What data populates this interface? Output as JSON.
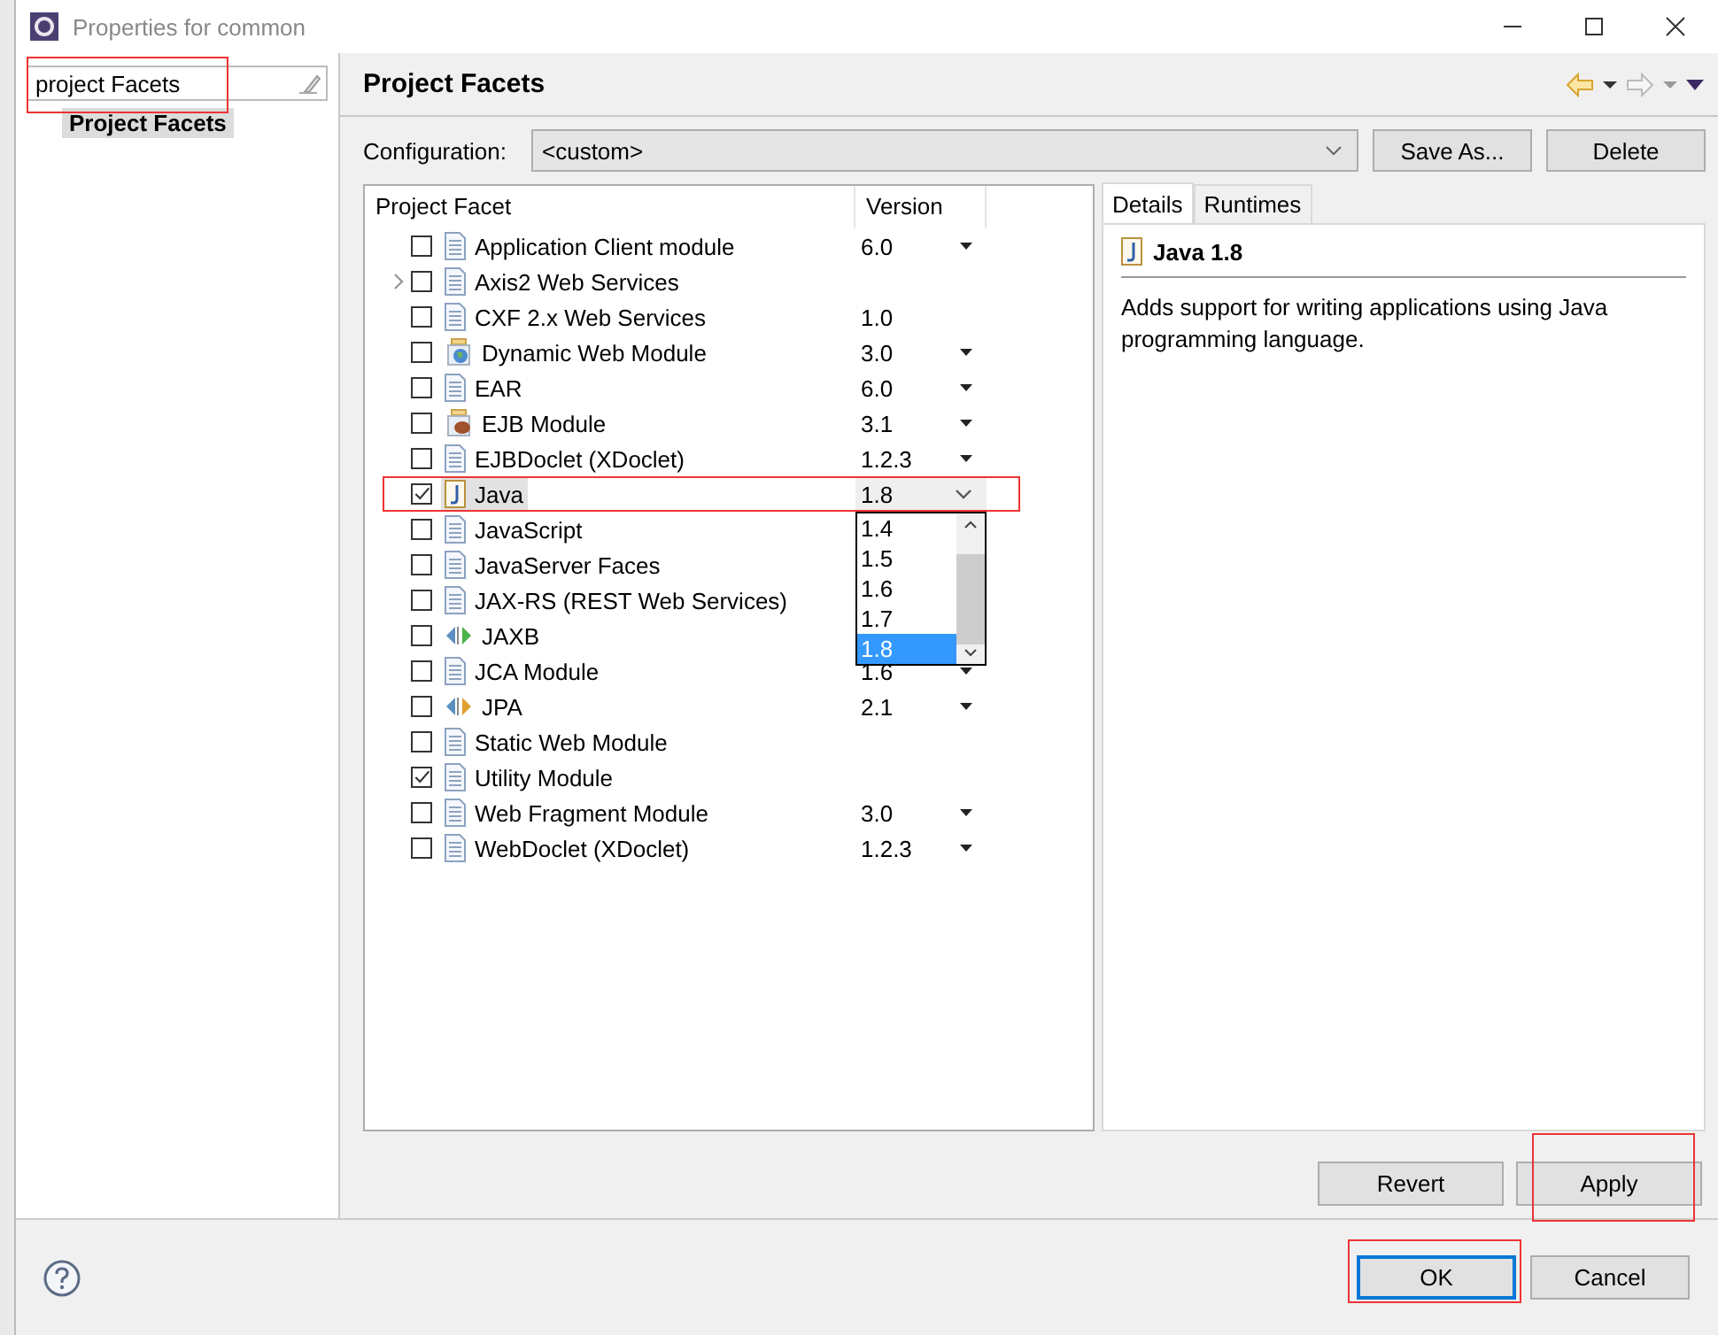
{
  "window": {
    "title": "Properties for common"
  },
  "filter": {
    "value": "project Facets"
  },
  "nav_tree": [
    {
      "label": "Project Facets",
      "selected": true
    }
  ],
  "page": {
    "title": "Project Facets"
  },
  "configuration": {
    "label": "Configuration:",
    "value": "<custom>"
  },
  "config_buttons": [
    "Save As...",
    "Delete"
  ],
  "facets_table": {
    "columns": [
      "Project Facet",
      "Version"
    ],
    "rows": [
      {
        "name": "Application Client module",
        "kind": "document",
        "checked": false,
        "expandable": false,
        "selected": false,
        "version": "6.0",
        "dropdown": true
      },
      {
        "name": "Axis2 Web Services",
        "kind": "document",
        "checked": false,
        "expandable": true,
        "selected": false,
        "dropdown": false
      },
      {
        "name": "CXF 2.x Web Services",
        "kind": "document",
        "checked": false,
        "expandable": false,
        "selected": false,
        "version": "1.0",
        "dropdown": false
      },
      {
        "name": "Dynamic Web Module",
        "kind": "web",
        "checked": false,
        "expandable": false,
        "selected": false,
        "version": "3.0",
        "dropdown": true
      },
      {
        "name": "EAR",
        "kind": "document",
        "checked": false,
        "expandable": false,
        "selected": false,
        "version": "6.0",
        "dropdown": true
      },
      {
        "name": "EJB Module",
        "kind": "bean",
        "checked": false,
        "expandable": false,
        "selected": false,
        "version": "3.1",
        "dropdown": true
      },
      {
        "name": "EJBDoclet (XDoclet)",
        "kind": "document",
        "checked": false,
        "expandable": false,
        "selected": false,
        "version": "1.2.3",
        "dropdown": true
      },
      {
        "name": "Java",
        "kind": "java",
        "checked": true,
        "expandable": false,
        "selected": true,
        "version": "1.8",
        "dropdown": true
      },
      {
        "name": "JavaScript",
        "kind": "document",
        "checked": false,
        "expandable": false,
        "selected": false
      },
      {
        "name": "JavaServer Faces",
        "kind": "document",
        "checked": false,
        "expandable": false,
        "selected": false
      },
      {
        "name": "JAX-RS (REST Web Services)",
        "kind": "document",
        "checked": false,
        "expandable": false,
        "selected": false
      },
      {
        "name": "JAXB",
        "kind": "binding-green",
        "checked": false,
        "expandable": false,
        "selected": false
      },
      {
        "name": "JCA Module",
        "kind": "document",
        "checked": false,
        "expandable": false,
        "selected": false,
        "version": "1.6",
        "dropdown": true
      },
      {
        "name": "JPA",
        "kind": "binding-orange",
        "checked": false,
        "expandable": false,
        "selected": false,
        "version": "2.1",
        "dropdown": true
      },
      {
        "name": "Static Web Module",
        "kind": "document",
        "checked": false,
        "expandable": false,
        "selected": false,
        "dropdown": false
      },
      {
        "name": "Utility Module",
        "kind": "document",
        "checked": true,
        "expandable": false,
        "selected": false,
        "dropdown": false
      },
      {
        "name": "Web Fragment Module",
        "kind": "document",
        "checked": false,
        "expandable": false,
        "selected": false,
        "version": "3.0",
        "dropdown": true
      },
      {
        "name": "WebDoclet (XDoclet)",
        "kind": "document",
        "checked": false,
        "expandable": false,
        "selected": false,
        "version": "1.2.3",
        "dropdown": true
      }
    ]
  },
  "version_popup": {
    "options": [
      {
        "label": "1.4",
        "selected": false
      },
      {
        "label": "1.5",
        "selected": false
      },
      {
        "label": "1.6",
        "selected": false
      },
      {
        "label": "1.7",
        "selected": false
      },
      {
        "label": "1.8",
        "selected": true
      }
    ]
  },
  "details": {
    "tabs": [
      {
        "label": "Details",
        "selected": true
      },
      {
        "label": "Runtimes",
        "selected": false
      }
    ],
    "title": "Java 1.8",
    "description": "Adds support for writing applications using Java programming language."
  },
  "page_buttons": [
    "Revert",
    "Apply"
  ],
  "dialog_buttons": [
    {
      "label": "OK",
      "default": true
    },
    {
      "label": "Cancel",
      "default": false
    }
  ]
}
